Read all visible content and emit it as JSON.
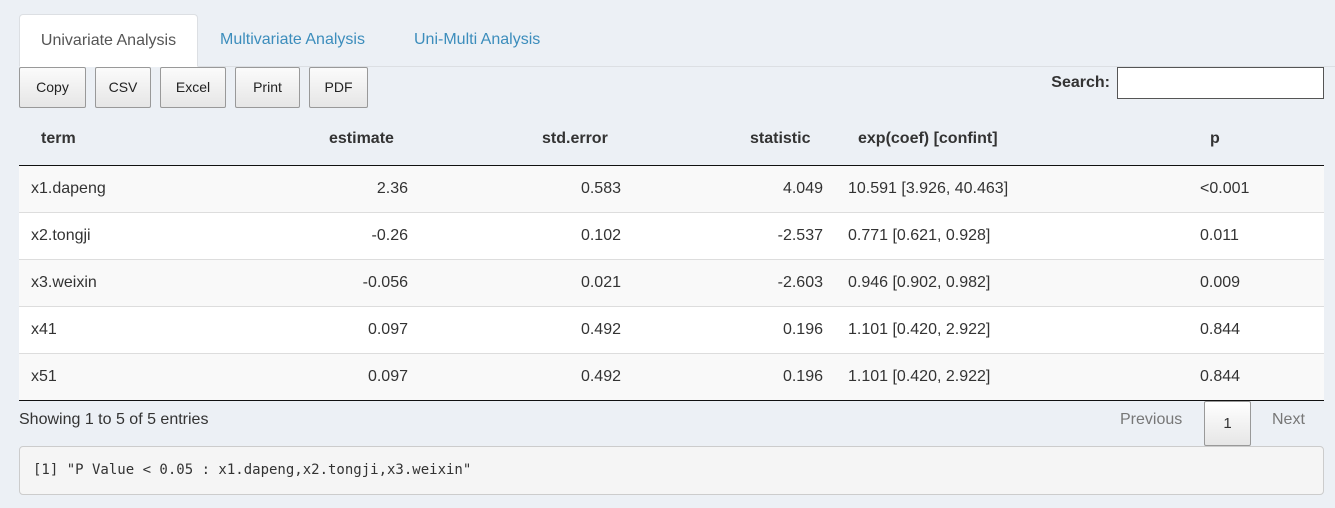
{
  "tabs": [
    {
      "label": "Univariate Analysis",
      "active": true
    },
    {
      "label": "Multivariate Analysis",
      "active": false
    },
    {
      "label": "Uni-Multi Analysis",
      "active": false
    }
  ],
  "buttons": [
    "Copy",
    "CSV",
    "Excel",
    "Print",
    "PDF"
  ],
  "search": {
    "label": "Search:",
    "value": ""
  },
  "table": {
    "headers": [
      "term",
      "estimate",
      "std.error",
      "statistic",
      "exp(coef) [confint]",
      "p"
    ],
    "rows": [
      [
        "x1.dapeng",
        "2.36",
        "0.583",
        "4.049",
        "10.591 [3.926, 40.463]",
        "<0.001"
      ],
      [
        "x2.tongji",
        "-0.26",
        "0.102",
        "-2.537",
        "0.771 [0.621, 0.928]",
        "0.011"
      ],
      [
        "x3.weixin",
        "-0.056",
        "0.021",
        "-2.603",
        "0.946 [0.902, 0.982]",
        "0.009"
      ],
      [
        "x41",
        "0.097",
        "0.492",
        "0.196",
        "1.101 [0.420, 2.922]",
        "0.844"
      ],
      [
        "x51",
        "0.097",
        "0.492",
        "0.196",
        "1.101 [0.420, 2.922]",
        "0.844"
      ]
    ]
  },
  "info": "Showing 1 to 5 of 5 entries",
  "pagination": {
    "previous": "Previous",
    "page": "1",
    "next": "Next"
  },
  "output": "[1] \"P Value < 0.05 : x1.dapeng,x2.tongji,x3.weixin\"",
  "colors": {
    "accent": "#3c8dbc",
    "background": "#ecf0f5"
  }
}
